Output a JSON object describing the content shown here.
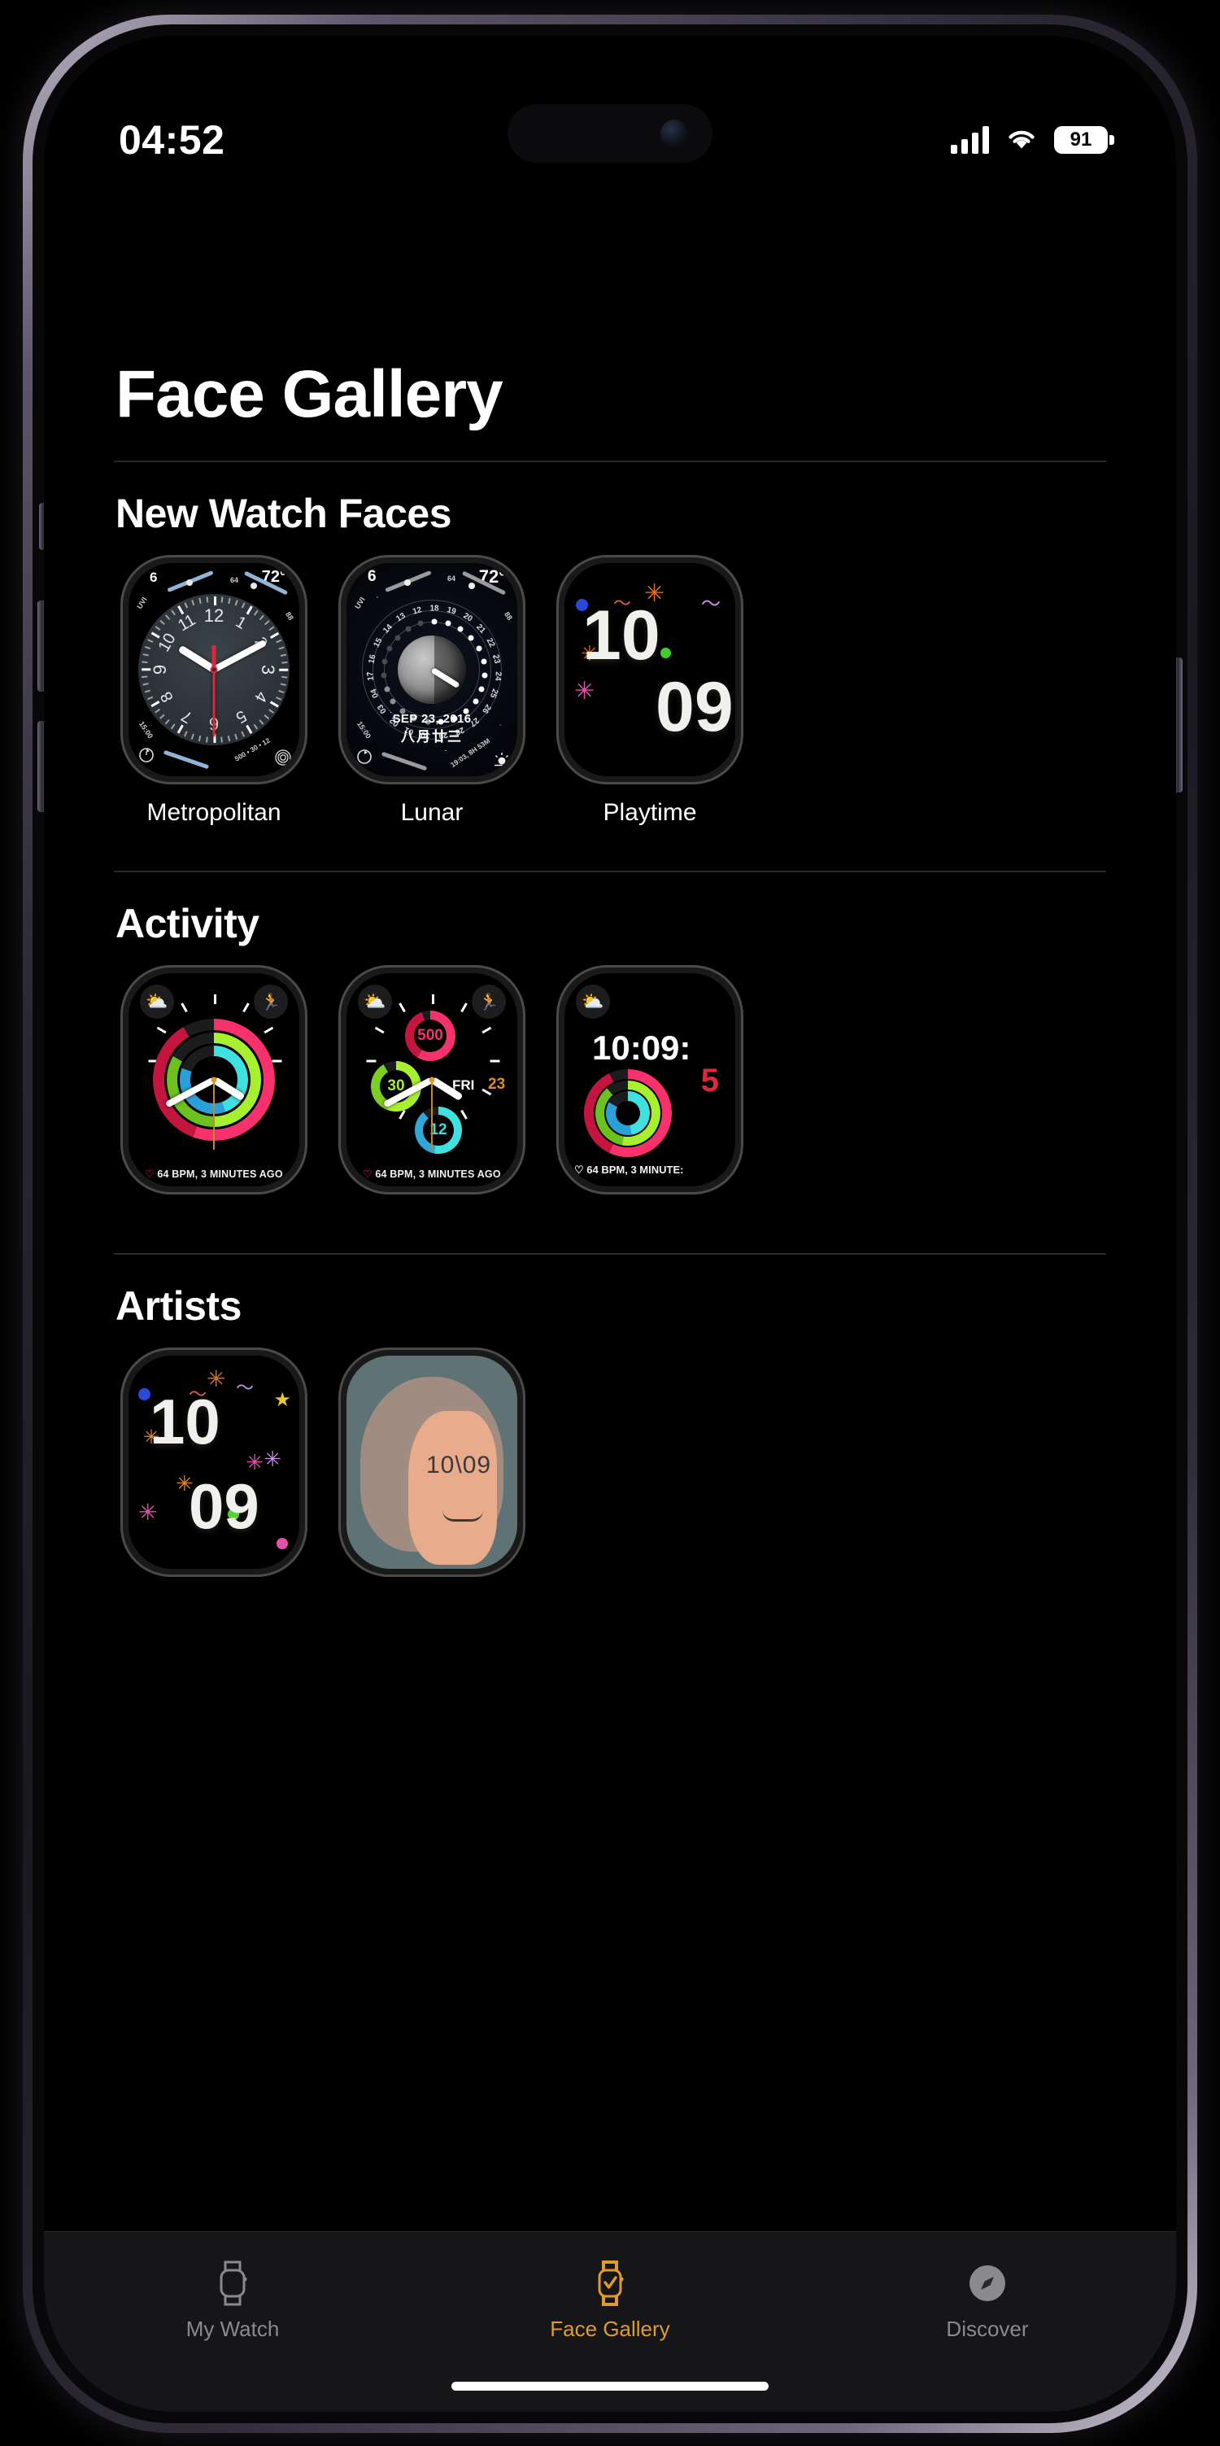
{
  "status_bar": {
    "time": "04:52",
    "signal_icon": "cellular-bars-icon",
    "wifi_icon": "wifi-icon",
    "battery_level": "91",
    "battery_icon": "battery-icon"
  },
  "header": {
    "title": "Face Gallery"
  },
  "sections": [
    {
      "id": "new-watch-faces",
      "title": "New Watch Faces",
      "faces": [
        {
          "label": "Metropolitan",
          "style": "metropolitan"
        },
        {
          "label": "Lunar",
          "style": "lunar"
        },
        {
          "label": "Playtime",
          "style": "playtime"
        }
      ]
    },
    {
      "id": "activity",
      "title": "Activity",
      "faces": [
        {
          "label": "",
          "style": "activity-analog"
        },
        {
          "label": "",
          "style": "activity-rings"
        },
        {
          "label": "",
          "style": "activity-digital"
        }
      ]
    },
    {
      "id": "artists",
      "title": "Artists",
      "faces": [
        {
          "label": "",
          "style": "playtime"
        },
        {
          "label": "",
          "style": "portrait"
        }
      ]
    }
  ],
  "metropolitan": {
    "uv_label": "UVI",
    "uv_value": "6",
    "temp_value": "72°",
    "temp_low": "64",
    "temp_high": "88",
    "timer_value": "15:00",
    "timer_icon": "timer-icon",
    "activity_values": "500 • 30 • 12",
    "activity_icon": "activity-rings-icon",
    "hour_numerals": [
      "12",
      "1",
      "2",
      "3",
      "4",
      "5",
      "6",
      "7",
      "8",
      "9",
      "10",
      "11"
    ]
  },
  "lunar": {
    "uv_label": "UVI",
    "uv_value": "6",
    "temp_value": "72°",
    "temp_low": "64",
    "temp_high": "88",
    "timer_value": "15:00",
    "timer_icon": "timer-icon",
    "date_gregorian": "SEP 23, 2016",
    "date_lunar": "八月廿三",
    "sunset_value": "19:03, 8H 53M",
    "sunset_icon": "sunset-icon",
    "calendar_days": [
      "18",
      "19",
      "20",
      "21",
      "22",
      "23",
      "24",
      "25",
      "26",
      "27",
      "28",
      "29",
      "30",
      "01",
      "02",
      "03",
      "04",
      "17",
      "16",
      "15",
      "14",
      "13",
      "12"
    ]
  },
  "activity_analog": {
    "weather_icon": "partly-cloudy-icon",
    "workout_icon": "running-icon",
    "heart_icon": "heart-icon",
    "heart_text": "64 BPM, 3 MINUTES AGO",
    "move_color": "#f6316b",
    "exercise_color": "#a6f030",
    "stand_color": "#3fe0e0"
  },
  "activity_rings": {
    "weather_icon": "partly-cloudy-icon",
    "workout_icon": "running-icon",
    "move_value": "500",
    "exercise_value": "30",
    "stand_value": "12",
    "date_weekday": "FRI",
    "date_day": "23",
    "heart_icon": "heart-icon",
    "heart_text": "64 BPM, 3 MINUTES AGO",
    "move_color": "#f6316b",
    "exercise_color": "#a6f030",
    "stand_color": "#3fe0e0",
    "date_accent": "#e08b24"
  },
  "activity_digital": {
    "weather_icon": "partly-cloudy-icon",
    "time_main": "10:09:",
    "time_seconds": "5",
    "heart_icon": "heart-icon",
    "heart_text": "64 BPM, 3 MINUTE:",
    "seconds_color": "#e0283c"
  },
  "playtime": {
    "hour": "10",
    "minute": "09"
  },
  "portrait": {
    "time": "10\\09"
  },
  "tab_bar": {
    "tabs": [
      {
        "label": "My Watch",
        "icon": "watch-icon",
        "active": false
      },
      {
        "label": "Face Gallery",
        "icon": "watch-check-icon",
        "active": true
      },
      {
        "label": "Discover",
        "icon": "compass-icon",
        "active": false
      }
    ],
    "active_color": "#e09b2d",
    "inactive_color": "#8a8a8e"
  }
}
